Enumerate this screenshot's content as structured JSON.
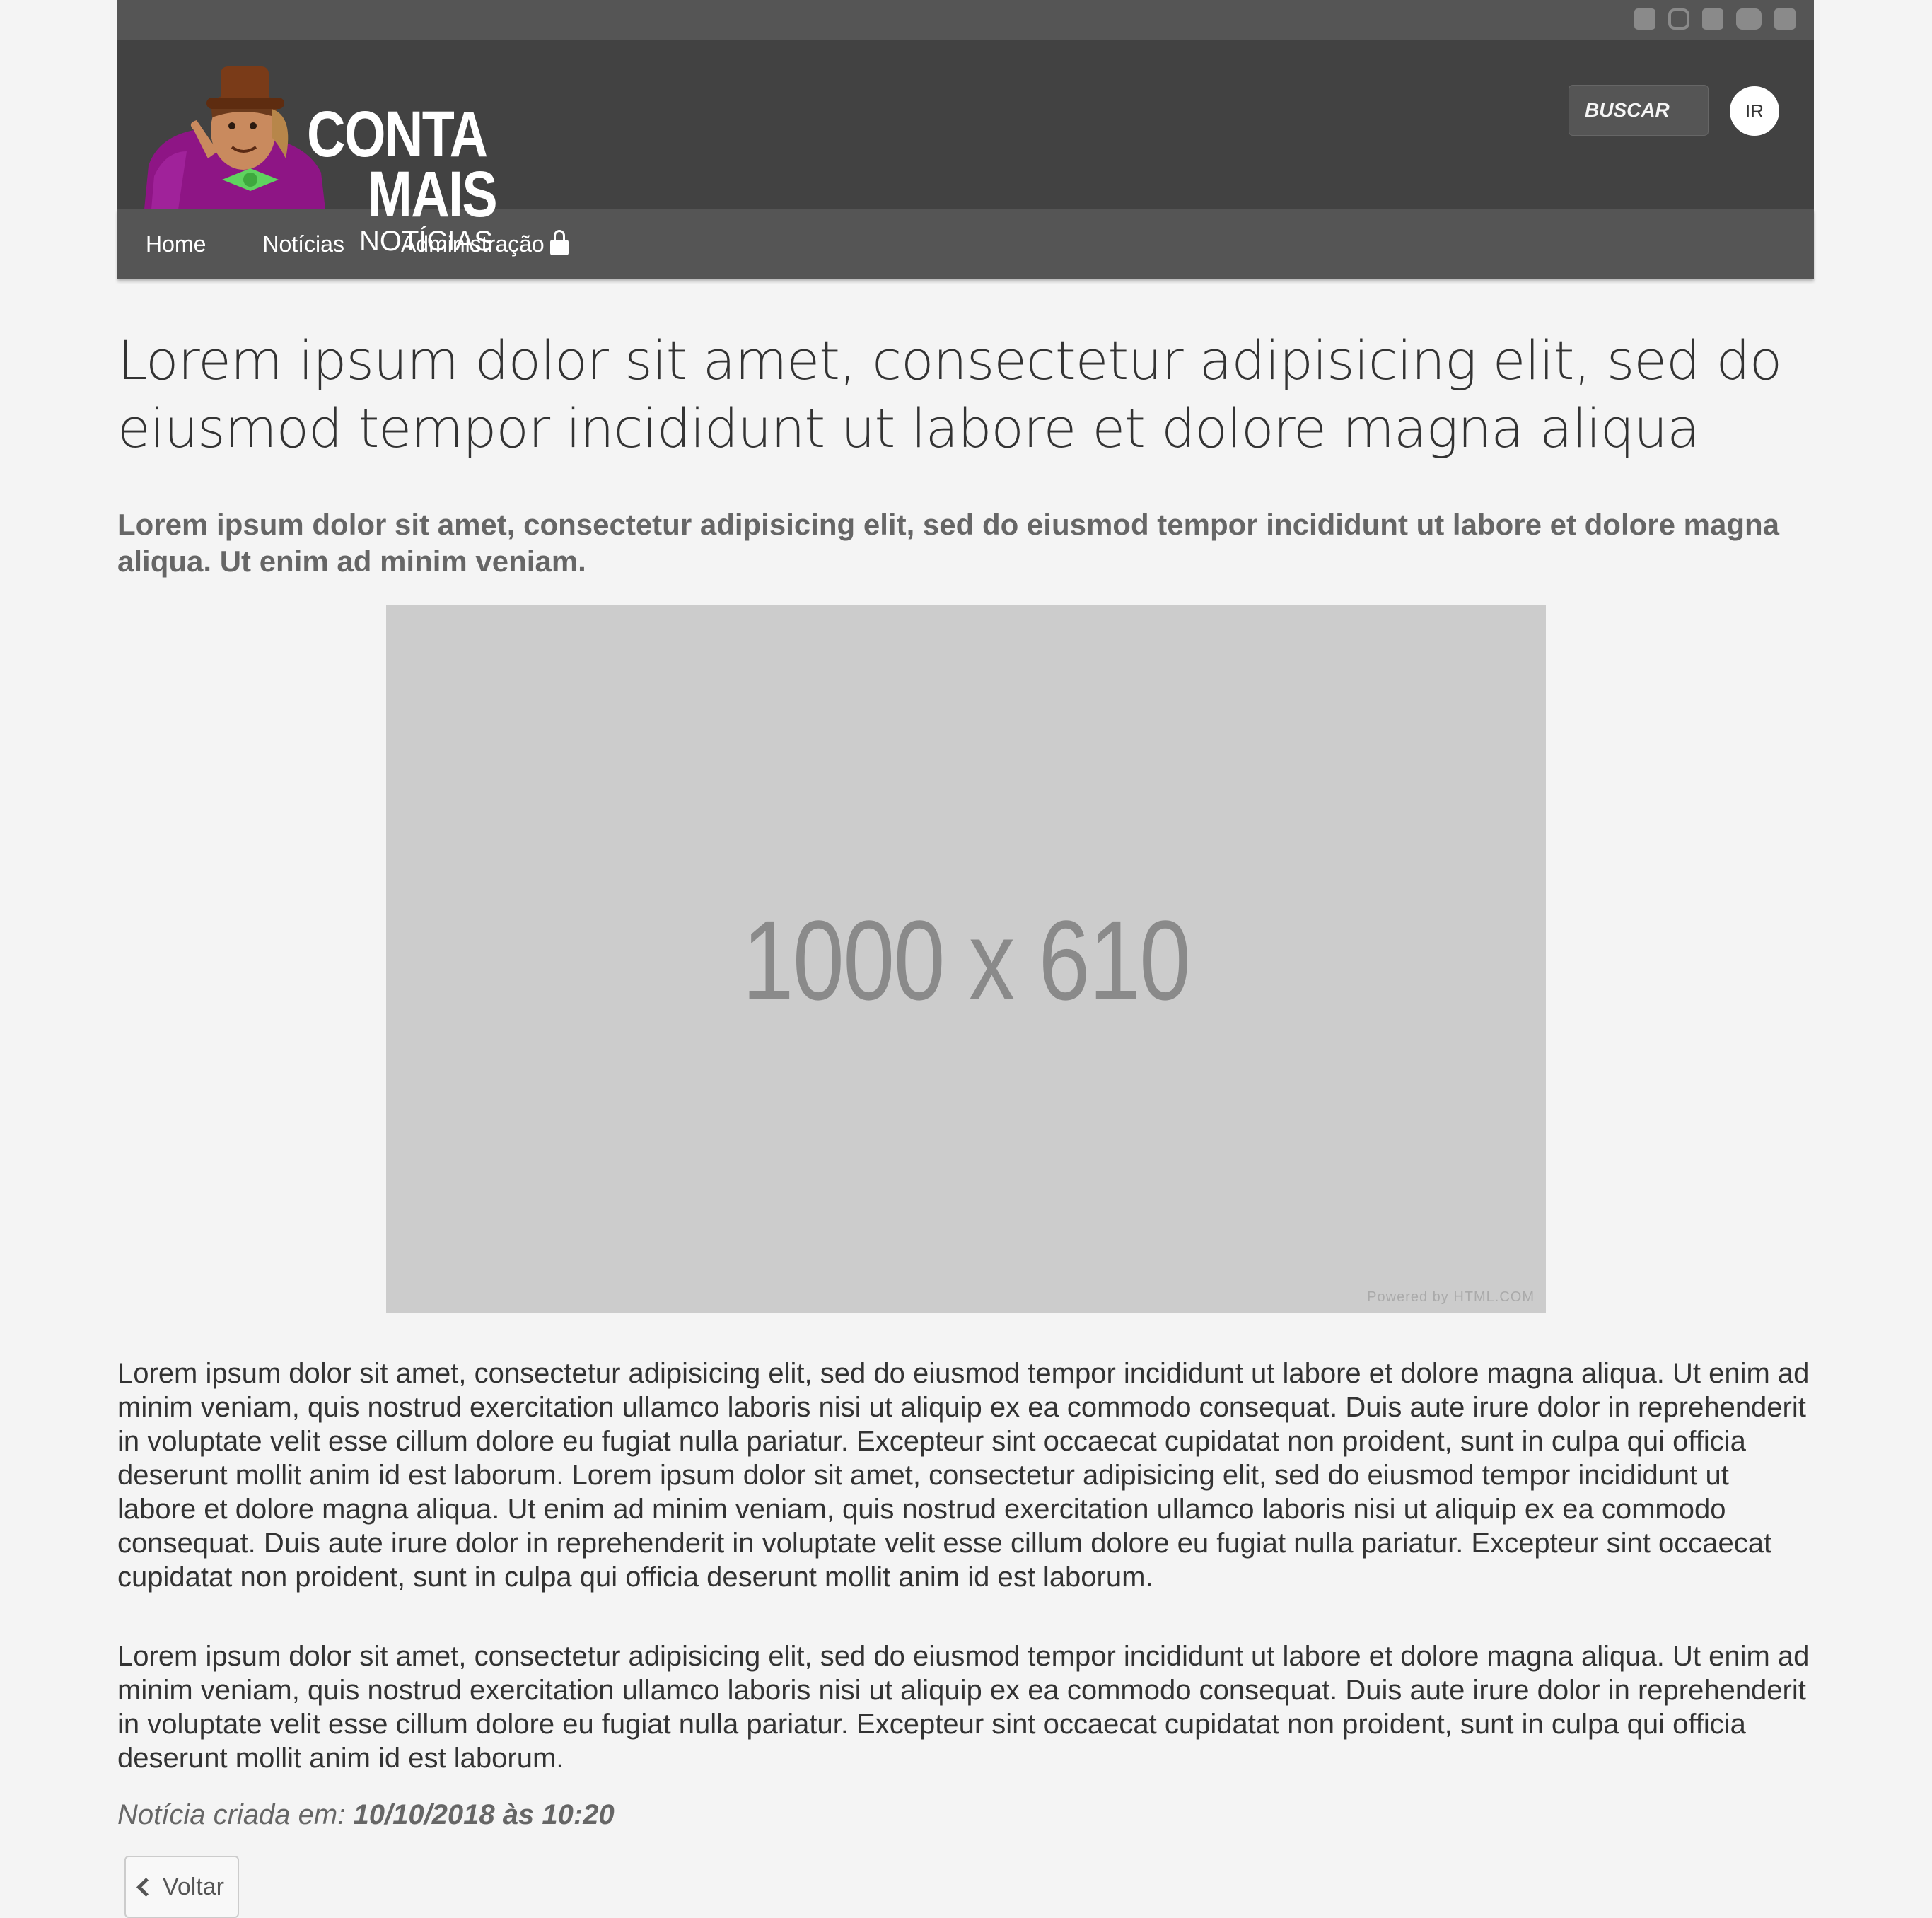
{
  "social": [
    "facebook-icon",
    "instagram-icon",
    "twitter-icon",
    "youtube-icon",
    "linkedin-icon"
  ],
  "logo": {
    "line1": "CONTA",
    "line2": "MAIS",
    "line3": "NOTÍCIAS"
  },
  "search": {
    "placeholder": "BUSCAR",
    "button": "IR"
  },
  "nav": {
    "home": "Home",
    "news": "Notícias",
    "admin": "Administração"
  },
  "article": {
    "title": "Lorem ipsum dolor sit amet, consectetur adipisicing elit, sed do eiusmod tempor incididunt ut labore et dolore magna aliqua",
    "subtitle": "Lorem ipsum dolor sit amet, consectetur adipisicing elit, sed do eiusmod tempor incididunt ut labore et dolore magna aliqua. Ut enim ad minim veniam.",
    "image_label": "1000 x 610",
    "image_credit": "Powered by HTML.COM",
    "paragraph1": "Lorem ipsum dolor sit amet, consectetur adipisicing elit, sed do eiusmod tempor incididunt ut labore et dolore magna aliqua. Ut enim ad minim veniam, quis nostrud exercitation ullamco laboris nisi ut aliquip ex ea commodo consequat. Duis aute irure dolor in reprehenderit in voluptate velit esse cillum dolore eu fugiat nulla pariatur. Excepteur sint occaecat cupidatat non proident, sunt in culpa qui officia deserunt mollit anim id est laborum. Lorem ipsum dolor sit amet, consectetur adipisicing elit, sed do eiusmod tempor incididunt ut labore et dolore magna aliqua. Ut enim ad minim veniam, quis nostrud exercitation ullamco laboris nisi ut aliquip ex ea commodo consequat. Duis aute irure dolor in reprehenderit in voluptate velit esse cillum dolore eu fugiat nulla pariatur. Excepteur sint occaecat cupidatat non proident, sunt in culpa qui officia deserunt mollit anim id est laborum.",
    "paragraph2": "Lorem ipsum dolor sit amet, consectetur adipisicing elit, sed do eiusmod tempor incididunt ut labore et dolore magna aliqua. Ut enim ad minim veniam, quis nostrud exercitation ullamco laboris nisi ut aliquip ex ea commodo consequat. Duis aute irure dolor in reprehenderit in voluptate velit esse cillum dolore eu fugiat nulla pariatur. Excepteur sint occaecat cupidatat non proident, sunt in culpa qui officia deserunt mollit anim id est laborum.",
    "created_label": "Notícia criada em:",
    "created_value": "10/10/2018 às 10:20",
    "back_label": "Voltar"
  }
}
